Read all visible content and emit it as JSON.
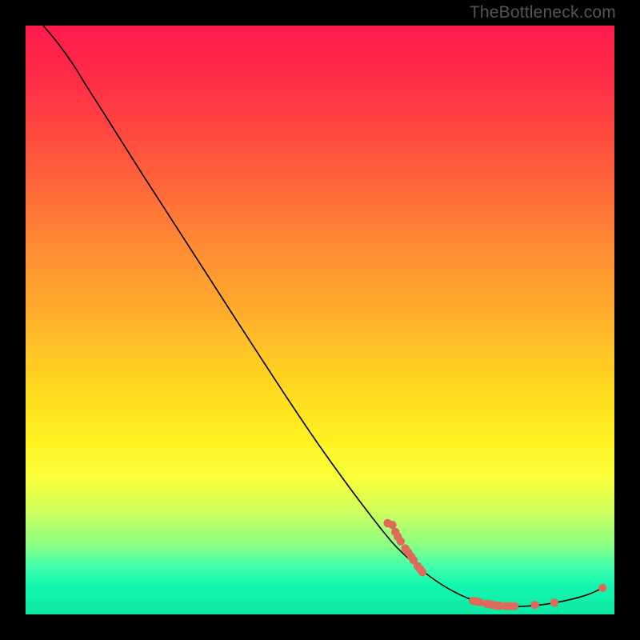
{
  "watermark": "TheBottleneck.com",
  "colors": {
    "dot": "#e06a5a",
    "curve": "#000000"
  },
  "chart_data": {
    "type": "line",
    "title": "",
    "xlabel": "",
    "ylabel": "",
    "xlim": [
      0,
      100
    ],
    "ylim": [
      0,
      100
    ],
    "curve": [
      {
        "x": 3.0,
        "y": 100.0
      },
      {
        "x": 5.5,
        "y": 97.0
      },
      {
        "x": 8.0,
        "y": 93.5
      },
      {
        "x": 10.5,
        "y": 89.5
      },
      {
        "x": 14.0,
        "y": 84.0
      },
      {
        "x": 20.0,
        "y": 74.5
      },
      {
        "x": 30.0,
        "y": 59.0
      },
      {
        "x": 40.0,
        "y": 43.5
      },
      {
        "x": 50.0,
        "y": 28.5
      },
      {
        "x": 60.0,
        "y": 15.0
      },
      {
        "x": 65.0,
        "y": 9.5
      },
      {
        "x": 70.0,
        "y": 5.5
      },
      {
        "x": 75.0,
        "y": 2.8
      },
      {
        "x": 80.0,
        "y": 1.5
      },
      {
        "x": 85.0,
        "y": 1.4
      },
      {
        "x": 90.0,
        "y": 2.0
      },
      {
        "x": 95.0,
        "y": 3.2
      },
      {
        "x": 98.0,
        "y": 4.5
      }
    ],
    "points_upper": [
      {
        "x": 61.5,
        "y": 15.5
      },
      {
        "x": 62.3,
        "y": 15.2
      },
      {
        "x": 62.8,
        "y": 14.0
      },
      {
        "x": 63.2,
        "y": 13.2
      },
      {
        "x": 63.7,
        "y": 12.4
      },
      {
        "x": 64.5,
        "y": 11.2
      },
      {
        "x": 65.0,
        "y": 10.5
      },
      {
        "x": 65.5,
        "y": 9.8
      },
      {
        "x": 65.9,
        "y": 9.2
      },
      {
        "x": 66.6,
        "y": 8.2
      },
      {
        "x": 67.0,
        "y": 7.7
      },
      {
        "x": 67.4,
        "y": 7.2
      }
    ],
    "points_lower": [
      {
        "x": 76.0,
        "y": 2.3
      },
      {
        "x": 76.6,
        "y": 2.2
      },
      {
        "x": 77.1,
        "y": 2.1
      },
      {
        "x": 78.3,
        "y": 1.8
      },
      {
        "x": 78.9,
        "y": 1.7
      },
      {
        "x": 79.4,
        "y": 1.6
      },
      {
        "x": 80.0,
        "y": 1.5
      },
      {
        "x": 80.5,
        "y": 1.5
      },
      {
        "x": 81.5,
        "y": 1.4
      },
      {
        "x": 82.2,
        "y": 1.4
      },
      {
        "x": 83.0,
        "y": 1.4
      },
      {
        "x": 86.5,
        "y": 1.6
      },
      {
        "x": 89.8,
        "y": 2.0
      },
      {
        "x": 98.0,
        "y": 4.5
      }
    ]
  }
}
